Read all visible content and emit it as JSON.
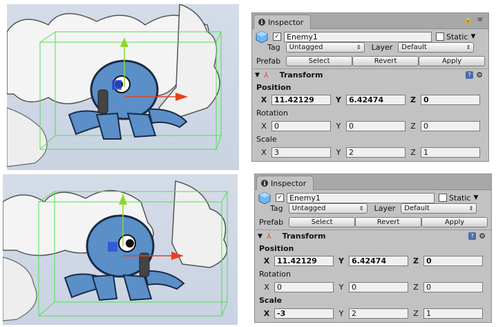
{
  "panels": [
    {
      "tab_label": "Inspector",
      "object_name": "Enemy1",
      "static_label": "Static",
      "tag_label": "Tag",
      "tag_value": "Untagged",
      "layer_label": "Layer",
      "layer_value": "Default",
      "prefab_label": "Prefab",
      "select_label": "Select",
      "revert_label": "Revert",
      "apply_label": "Apply",
      "component_title": "Transform",
      "position_label": "Position",
      "position": {
        "x": "11.42129",
        "y": "6.42474",
        "z": "0"
      },
      "rotation_label": "Rotation",
      "rotation": {
        "x": "0",
        "y": "0",
        "z": "0"
      },
      "scale_label": "Scale",
      "scale": {
        "x": "3",
        "y": "2",
        "z": "1"
      },
      "axis": {
        "x": "X",
        "y": "Y",
        "z": "Z"
      }
    },
    {
      "tab_label": "Inspector",
      "object_name": "Enemy1",
      "static_label": "Static",
      "tag_label": "Tag",
      "tag_value": "Untagged",
      "layer_label": "Layer",
      "layer_value": "Default",
      "prefab_label": "Prefab",
      "select_label": "Select",
      "revert_label": "Revert",
      "apply_label": "Apply",
      "component_title": "Transform",
      "position_label": "Position",
      "position": {
        "x": "11.42129",
        "y": "6.42474",
        "z": "0"
      },
      "rotation_label": "Rotation",
      "rotation": {
        "x": "0",
        "y": "0",
        "z": "0"
      },
      "scale_label": "Scale",
      "scale": {
        "x": "-3",
        "y": "2",
        "z": "1"
      },
      "axis": {
        "x": "X",
        "y": "Y",
        "z": "Z"
      }
    }
  ],
  "colors": {
    "panel_bg": "#c2c2c2",
    "octopus": "#5a8fc8",
    "gizmo_y": "#8fd82c",
    "gizmo_x": "#e8401c",
    "bounds": "#4fe04f"
  }
}
